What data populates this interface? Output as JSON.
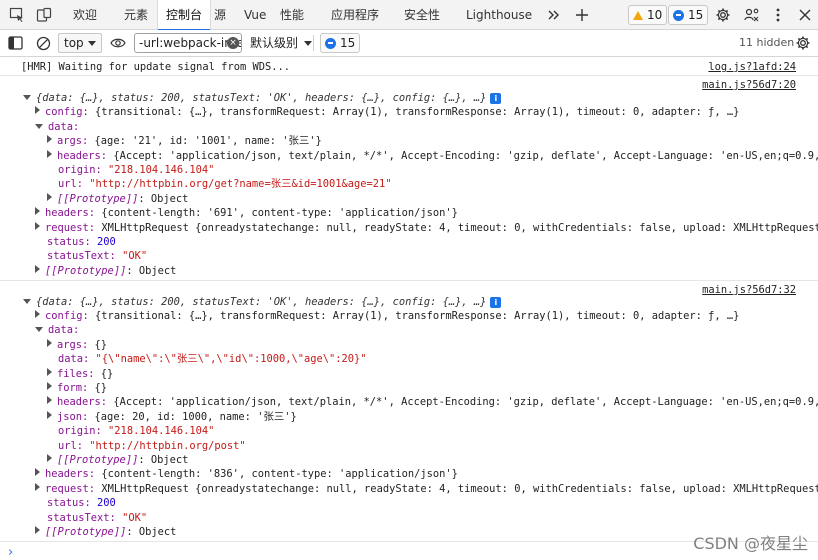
{
  "tabs": [
    {
      "label": "欢迎"
    },
    {
      "label": "元素"
    },
    {
      "label": "控制台"
    },
    {
      "label": "源"
    },
    {
      "label": "Vue"
    },
    {
      "label": "性能"
    },
    {
      "label": "应用程序"
    },
    {
      "label": "安全性"
    },
    {
      "label": "Lighthouse"
    }
  ],
  "badges": {
    "warnings": "10",
    "messages": "15"
  },
  "toolbar": {
    "context": "top",
    "filter_value": "-url:webpack-internal",
    "level": "默认级别",
    "messages": "15",
    "hidden": "11 hidden"
  },
  "logs": {
    "hmr": {
      "text": "[HMR] Waiting for update signal from WDS...",
      "source": "log.js?1afd:24"
    },
    "entry1": {
      "source": "main.js?56d7:20",
      "summary": "{data: {…}, status: 200, statusText: 'OK', headers: {…}, config: {…}, …}",
      "config": "{transitional: {…}, transformRequest: Array(1), transformResponse: Array(1), timeout: 0, adapter: ƒ, …}",
      "args": "{age: '21', id: '1001', name: '张三'}",
      "headers": "{Accept: 'application/json, text/plain, */*', Accept-Encoding: 'gzip, deflate', Accept-Language: 'en-US,en;q=0.9,zh…",
      "origin": "\"218.104.146.104\"",
      "url": "\"http://httpbin.org/get?name=张三&id=1001&age=21\"",
      "resp_headers": "{content-length: '691', content-type: 'application/json'}",
      "request": "XMLHttpRequest {onreadystatechange: null, readyState: 4, timeout: 0, withCredentials: false, upload: XMLHttpRequestUp…",
      "status": "200",
      "statusText": "\"OK\""
    },
    "entry2": {
      "source": "main.js?56d7:32",
      "summary": "{data: {…}, status: 200, statusText: 'OK', headers: {…}, config: {…}, …}",
      "config": "{transitional: {…}, transformRequest: Array(1), transformResponse: Array(1), timeout: 0, adapter: ƒ, …}",
      "args": "{}",
      "data": "\"{\\\"name\\\":\\\"张三\\\",\\\"id\\\":1000,\\\"age\\\":20}\"",
      "files": "{}",
      "form": "{}",
      "headers": "{Accept: 'application/json, text/plain, */*', Accept-Encoding: 'gzip, deflate', Accept-Language: 'en-US,en;q=0.9,zh…",
      "json": "{age: 20, id: 1000, name: '张三'}",
      "origin": "\"218.104.146.104\"",
      "url": "\"http://httpbin.org/post\"",
      "resp_headers": "{content-length: '836', content-type: 'application/json'}",
      "request": "XMLHttpRequest {onreadystatechange: null, readyState: 4, timeout: 0, withCredentials: false, upload: XMLHttpRequestUp…",
      "status": "200",
      "statusText": "\"OK\""
    }
  },
  "labels": {
    "config": "config: ",
    "data": "data:",
    "args": "args: ",
    "headers": "headers: ",
    "origin": "origin: ",
    "url": "url: ",
    "prototype": "[[Prototype]]",
    "prototype_value": ": Object",
    "request": "request: ",
    "status": "status: ",
    "statusText": "statusText: ",
    "data_str": "data: ",
    "files": "files: ",
    "form": "form: ",
    "json": "json: "
  },
  "prompt": "›",
  "watermark": "CSDN @夜星尘"
}
